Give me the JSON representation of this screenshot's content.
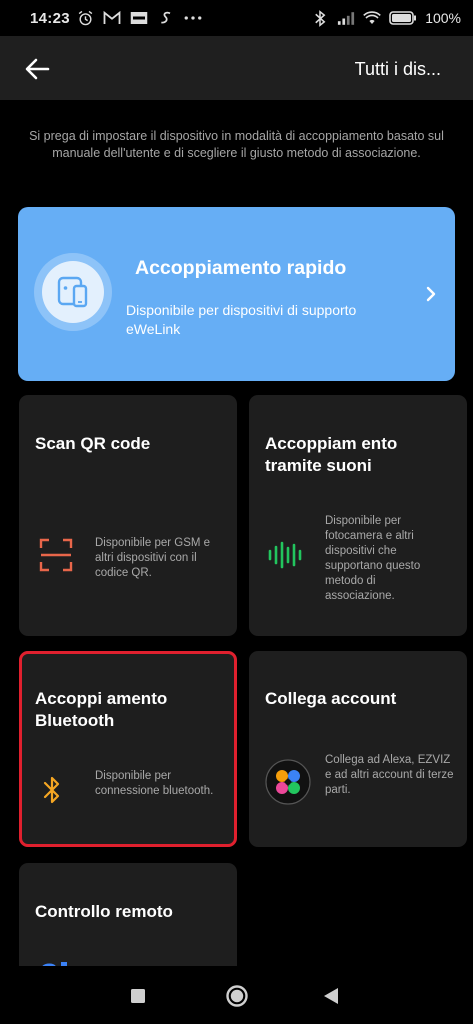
{
  "status": {
    "time": "14:23",
    "battery": "100%",
    "left_icons": [
      "alarm-icon",
      "gmail-icon",
      "ifttt-icon",
      "s-icon",
      "more-icon"
    ],
    "right_icons": [
      "bluetooth-icon",
      "signal-icon",
      "wifi-icon",
      "battery-icon"
    ]
  },
  "header": {
    "title": "Tutti i dis..."
  },
  "intro": "Si prega di impostare il dispositivo in modalità di accoppiamento basato sul manuale dell'utente e di scegliere il giusto metodo di associazione.",
  "quick": {
    "title": "Accoppiamento rapido",
    "desc": "Disponibile per dispositivi di supporto eWeLink"
  },
  "cards": {
    "qr": {
      "title": "Scan QR code",
      "desc": "Disponibile per GSM e altri dispositivi con il codice QR."
    },
    "sound": {
      "title": "Accoppiam ento tramite suoni",
      "desc": "Disponibile per fotocamera e altri dispositivi che supportano questo metodo di associazione."
    },
    "bluetooth": {
      "title": "Accoppi amento Bluetooth",
      "desc": "Disponibile per connessione bluetooth."
    },
    "account": {
      "title": "Collega account",
      "desc": "Collega ad Alexa, EZVIZ e ad altri account di terze parti."
    },
    "remote": {
      "title": "Controllo remoto"
    }
  },
  "colors": {
    "quick_card": "#66aef5",
    "qr_icon": "#e8664a",
    "sound_icon": "#22c55e",
    "bluetooth_icon": "#f5a623",
    "selected_border": "#e0202e"
  }
}
